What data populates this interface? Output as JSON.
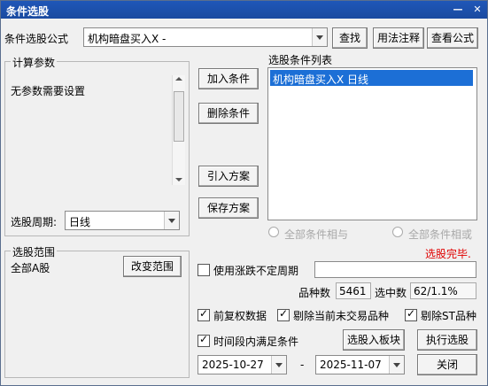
{
  "window": {
    "title": "条件选股"
  },
  "top": {
    "formula_label": "条件选股公式",
    "formula_value": "机构暗盘买入X  -",
    "find_btn": "查找",
    "usage_btn": "用法注释",
    "view_formula_btn": "查看公式"
  },
  "params": {
    "group_label": "计算参数",
    "no_params_text": "无参数需要设置",
    "period_label": "选股周期:",
    "period_value": "日线"
  },
  "actions": {
    "add": "加入条件",
    "delete": "删除条件",
    "import": "引入方案",
    "save": "保存方案"
  },
  "conditions": {
    "label": "选股条件列表",
    "items": [
      "机构暗盘买入X  日线"
    ],
    "and_label": "全部条件相与",
    "or_label": "全部条件相或"
  },
  "range": {
    "group_label": "选股范围",
    "value": "全部A股",
    "change_btn": "改变范围"
  },
  "status": {
    "done_text": "选股完毕.",
    "done_color": "#e00000"
  },
  "options": {
    "use_irregular_period": "使用涨跌不定周期",
    "count_label": "品种数",
    "count_value": "5461",
    "selected_label": "选中数",
    "selected_value": "62/1.1%",
    "forward_adj": "前复权数据",
    "exclude_untraded": "剔除当前未交易品种",
    "exclude_st": "剔除ST品种",
    "time_range": "时间段内满足条件"
  },
  "buttons": {
    "to_block": "选股入板块",
    "execute": "执行选股",
    "close": "关闭"
  },
  "dates": {
    "start": "2025-10-27",
    "separator": "-",
    "end": "2025-11-07"
  }
}
